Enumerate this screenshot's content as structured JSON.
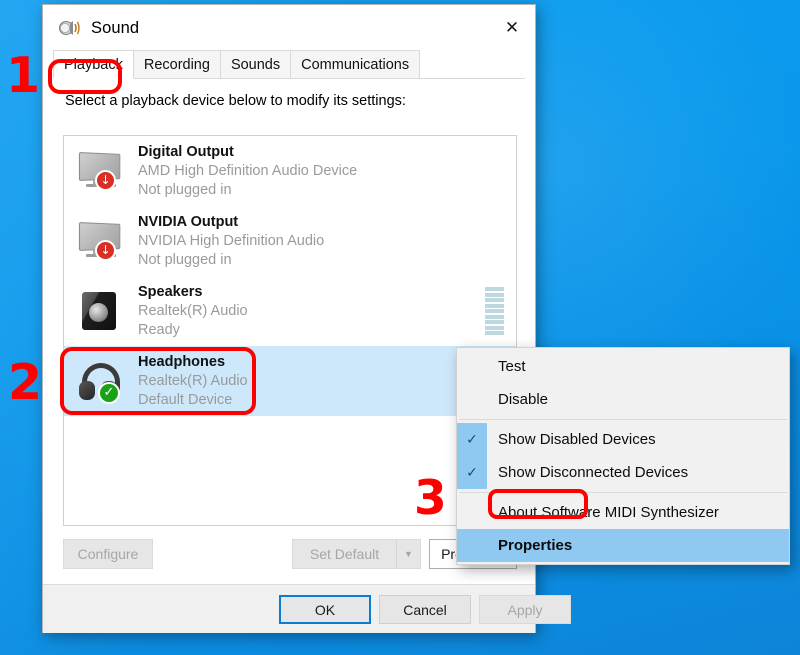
{
  "window": {
    "title": "Sound",
    "title_icon": "speaker-icon",
    "close_label": "✕"
  },
  "tabs": [
    {
      "label": "Playback",
      "active": true
    },
    {
      "label": "Recording",
      "active": false
    },
    {
      "label": "Sounds",
      "active": false
    },
    {
      "label": "Communications",
      "active": false
    }
  ],
  "hint": "Select a playback device below to modify its settings:",
  "devices": [
    {
      "name": "Digital Output",
      "driver": "AMD High Definition Audio Device",
      "state": "Not plugged in",
      "icon": "monitor-icon",
      "badge": "down-arrow-badge",
      "badge_glyph": "↓",
      "selected": false,
      "meter": false
    },
    {
      "name": "NVIDIA Output",
      "driver": "NVIDIA High Definition Audio",
      "state": "Not plugged in",
      "icon": "monitor-icon",
      "badge": "down-arrow-badge",
      "badge_glyph": "↓",
      "selected": false,
      "meter": false
    },
    {
      "name": "Speakers",
      "driver": "Realtek(R) Audio",
      "state": "Ready",
      "icon": "speaker-icon",
      "badge": "none",
      "badge_glyph": "",
      "selected": false,
      "meter": true
    },
    {
      "name": "Headphones",
      "driver": "Realtek(R) Audio",
      "state": "Default Device",
      "icon": "headphones-icon",
      "badge": "green-check-badge",
      "badge_glyph": "✓",
      "selected": true,
      "meter": false
    }
  ],
  "meter_segments": 9,
  "buttons": {
    "configure": "Configure",
    "set_default": "Set Default",
    "set_default_arrow": "▼",
    "properties": "Properties"
  },
  "footer_buttons": {
    "ok": "OK",
    "cancel": "Cancel",
    "apply": "Apply"
  },
  "context_menu": [
    {
      "label": "Test",
      "checked": false,
      "highlight": false
    },
    {
      "label": "Disable",
      "checked": false,
      "highlight": false
    },
    {
      "label": "Show Disabled Devices",
      "checked": true,
      "highlight": false
    },
    {
      "label": "Show Disconnected Devices",
      "checked": true,
      "highlight": false
    },
    {
      "label": "About Software MIDI Synthesizer",
      "checked": false,
      "highlight": false
    },
    {
      "label": "Properties",
      "checked": false,
      "highlight": true
    }
  ],
  "check_glyph": "✓",
  "annotations": {
    "step1": "1",
    "step2": "2",
    "step3": "3"
  },
  "colors": {
    "desktop_blue": "#0a98ec",
    "annotation_red": "#ff0000",
    "selection_blue": "#cde8fb",
    "menu_highlight": "#8fc9f2",
    "badge_red": "#d93025",
    "badge_green": "#18a218",
    "meter_segment": "#bcd9e2",
    "focus_border": "#0a7cd1"
  }
}
